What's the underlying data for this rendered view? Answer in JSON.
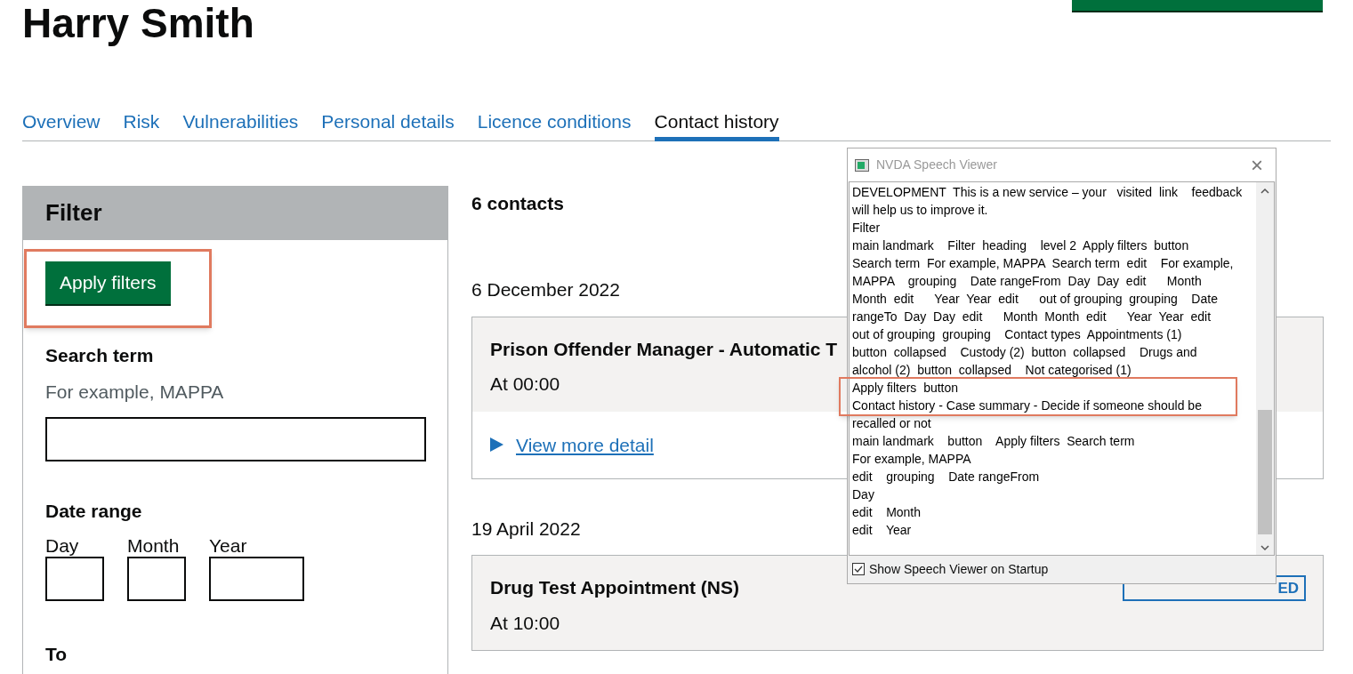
{
  "heading": "Harry Smith",
  "tabs": [
    {
      "label": "Overview",
      "selected": false
    },
    {
      "label": "Risk",
      "selected": false
    },
    {
      "label": "Vulnerabilities",
      "selected": false
    },
    {
      "label": "Personal details",
      "selected": false
    },
    {
      "label": "Licence conditions",
      "selected": false
    },
    {
      "label": "Contact history",
      "selected": true
    }
  ],
  "filter": {
    "title": "Filter",
    "apply_button": "Apply filters",
    "search_label": "Search term",
    "search_hint": "For example, MAPPA",
    "date_range_label": "Date range",
    "date_fields": [
      "Day",
      "Month",
      "Year"
    ],
    "to_label": "To"
  },
  "contacts_count": "6 contacts",
  "groups": [
    {
      "date": "6 December 2022",
      "title": "Prison Offender Manager - Automatic T",
      "time": "At 00:00",
      "detail_link": "View more detail"
    },
    {
      "date": "19 April 2022",
      "title": "Drug Test Appointment (NS)",
      "time": "At 10:00",
      "badge": "ED"
    }
  ],
  "speech_viewer": {
    "title": "NVDA Speech Viewer",
    "close": "×",
    "lines": [
      "DEVELOPMENT  This is a new service – your   visited  link    feedback",
      "will help us to improve it.",
      "Filter",
      "main landmark    Filter  heading    level 2  Apply filters  button",
      "Search term  For example, MAPPA  Search term  edit    For example,",
      "MAPPA    grouping    Date rangeFrom  Day  Day  edit      Month",
      "Month  edit      Year  Year  edit      out of grouping  grouping    Date",
      "rangeTo  Day  Day  edit      Month  Month  edit      Year  Year  edit",
      "out of grouping  grouping    Contact types  Appointments (1)",
      "button  collapsed    Custody (2)  button  collapsed    Drugs and",
      "alcohol (2)  button  collapsed    Not categorised (1)",
      "Apply filters  button",
      "Contact history - Case summary - Decide if someone should be",
      "recalled or not",
      "main landmark    button    Apply filters  Search term",
      "For example, MAPPA",
      "edit    grouping    Date rangeFrom",
      "Day",
      "edit    Month",
      "edit    Year"
    ],
    "startup_checkbox": {
      "label": "Show Speech Viewer on Startup",
      "checked": true
    }
  }
}
